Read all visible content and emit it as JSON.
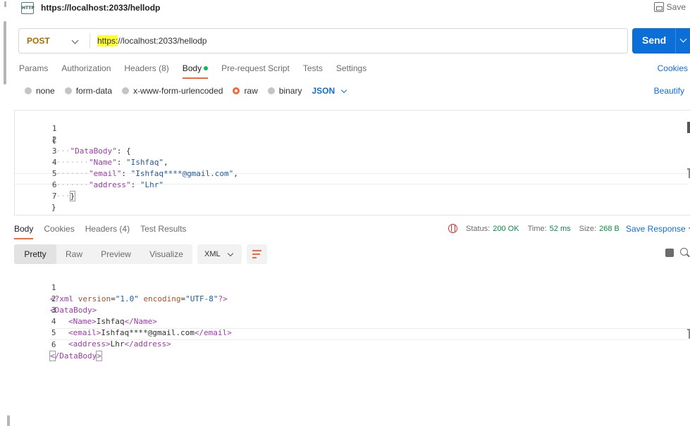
{
  "tab": {
    "icon_text": "HTTP",
    "title": "https://localhost:2033/hellodp",
    "save_label": "Save"
  },
  "request": {
    "method": "POST",
    "url_scheme": "https:",
    "url_rest": "//localhost:2033/hellodp",
    "send_label": "Send"
  },
  "req_tabs": {
    "params": "Params",
    "authorization": "Authorization",
    "headers": "Headers (8)",
    "body": "Body",
    "prerequest": "Pre-request Script",
    "tests": "Tests",
    "settings": "Settings",
    "cookies": "Cookies"
  },
  "body_types": {
    "none": "none",
    "form_data": "form-data",
    "urlencoded": "x-www-form-urlencoded",
    "raw": "raw",
    "binary": "binary",
    "format": "JSON",
    "beautify": "Beautify"
  },
  "request_body": {
    "line_numbers": [
      "1",
      "2",
      "3",
      "4",
      "5",
      "6",
      "7"
    ],
    "l1": "{",
    "l2_dots": "····",
    "l2_key": "\"DataBody\"",
    "l2_punc": ": {",
    "l3_dots": "········",
    "l3_key": "\"Name\"",
    "l3_punc": ": ",
    "l3_val": "\"Ishfaq\"",
    "l3_end": ",",
    "l4_dots": "········",
    "l4_key": "\"email\"",
    "l4_punc": ": ",
    "l4_val": "\"Ishfaq****@gmail.com\"",
    "l4_end": ",",
    "l5_dots": "········",
    "l5_key": "\"address\"",
    "l5_punc": ": ",
    "l5_val": "\"Lhr\"",
    "l6_dots": "····",
    "l6_punc": "}",
    "l7": "}"
  },
  "response": {
    "tabs": {
      "body": "Body",
      "cookies": "Cookies",
      "headers": "Headers (4)",
      "tests": "Test Results"
    },
    "status_label": "Status:",
    "status_value": "200 OK",
    "time_label": "Time:",
    "time_value": "52 ms",
    "size_label": "Size:",
    "size_value": "268 B",
    "save_response": "Save Response",
    "views": {
      "pretty": "Pretty",
      "raw": "Raw",
      "preview": "Preview",
      "visualize": "Visualize"
    },
    "format": "XML",
    "line_numbers": [
      "1",
      "2",
      "3",
      "4",
      "5",
      "6"
    ],
    "r1_open": "<?xml ",
    "r1_attr1": "version",
    "r1_eq1": "=",
    "r1_val1": "\"1.0\"",
    "r1_attr2": " encoding",
    "r1_eq2": "=",
    "r1_val2": "\"UTF-8\"",
    "r1_close": "?>",
    "r2": "<DataBody>",
    "r3_open": "<Name>",
    "r3_text": "Ishfaq",
    "r3_close": "</Name>",
    "r4_open": "<email>",
    "r4_text": "Ishfaq****@gmail.com",
    "r4_close": "</email>",
    "r5_open": "<address>",
    "r5_text": "Lhr",
    "r5_close": "</address>",
    "r6_lt": "<",
    "r6_rest": "/DataBody",
    "r6_gt": ">"
  },
  "colors": {
    "accent": "#0c6fd8",
    "active_tab": "#f26b3a",
    "method": "#a67000",
    "status_ok": "#0c8a4a"
  }
}
